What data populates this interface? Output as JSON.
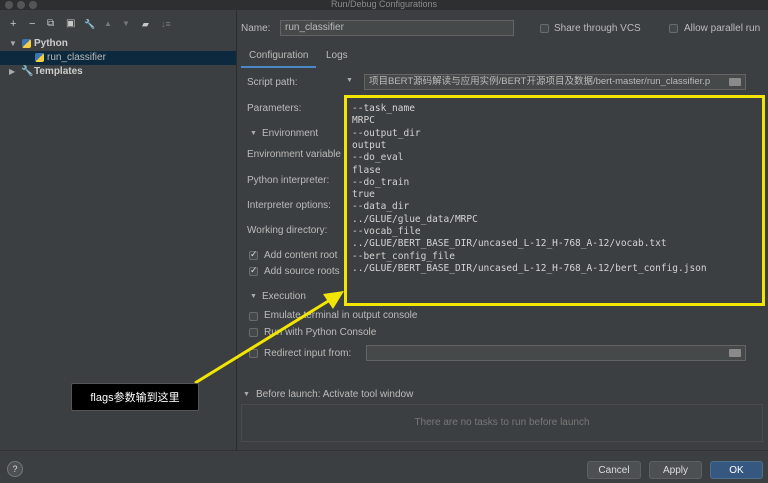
{
  "window": {
    "title": "Run/Debug Configurations"
  },
  "toolbar": {
    "add": "+",
    "remove": "−",
    "copy": "⧉",
    "save": "▣",
    "edit_defaults": "🔧",
    "move_up": "▲",
    "move_down": "▼",
    "folder": "▰",
    "sort": "↓≡"
  },
  "tree": {
    "python": "Python",
    "run_classifier": "run_classifier",
    "templates": "Templates"
  },
  "name_field": {
    "label": "Name:",
    "value": "run_classifier"
  },
  "share_vcs": {
    "label": "Share through VCS",
    "checked": false
  },
  "allow_parallel": {
    "label": "Allow parallel run",
    "checked": false
  },
  "tabs": {
    "configuration": "Configuration",
    "logs": "Logs"
  },
  "config": {
    "script_path_label": "Script path:",
    "script_path_value": "项目BERT源码解读与应用实例/BERT开源项目及数据/bert-master/run_classifier.p",
    "parameters_label": "Parameters:",
    "environment_section": "Environment",
    "env_vars_label": "Environment variable",
    "python_interpreter_label": "Python interpreter:",
    "interpreter_options_label": "Interpreter options:",
    "working_directory_label": "Working directory:",
    "add_content_roots": "Add content root",
    "add_source_roots": "Add source roots",
    "execution_section": "Execution",
    "emulate_terminal": "Emulate terminal in output console",
    "run_with_console": "Run with Python Console",
    "redirect_input": "Redirect input from:"
  },
  "parameters_lines": [
    "--task_name",
    "MRPC",
    "--output_dir",
    "output",
    "--do_eval",
    "flase",
    "--do_train",
    "true",
    "--data_dir",
    "../GLUE/glue_data/MRPC",
    "--vocab_file",
    "../GLUE/BERT_BASE_DIR/uncased_L-12_H-768_A-12/vocab.txt",
    "--bert_config_file",
    "../GLUE/BERT_BASE_DIR/uncased_L-12_H-768_A-12/bert_config.json"
  ],
  "annotation": {
    "text": "flags参数输到这里"
  },
  "before_launch": {
    "title": "Before launch: Activate tool window",
    "empty_text": "There are no tasks to run before launch"
  },
  "buttons": {
    "help": "?",
    "cancel": "Cancel",
    "apply": "Apply",
    "ok": "OK"
  },
  "colors": {
    "highlight": "#f2e600",
    "primary": "#365880",
    "background": "#3c3f41"
  }
}
